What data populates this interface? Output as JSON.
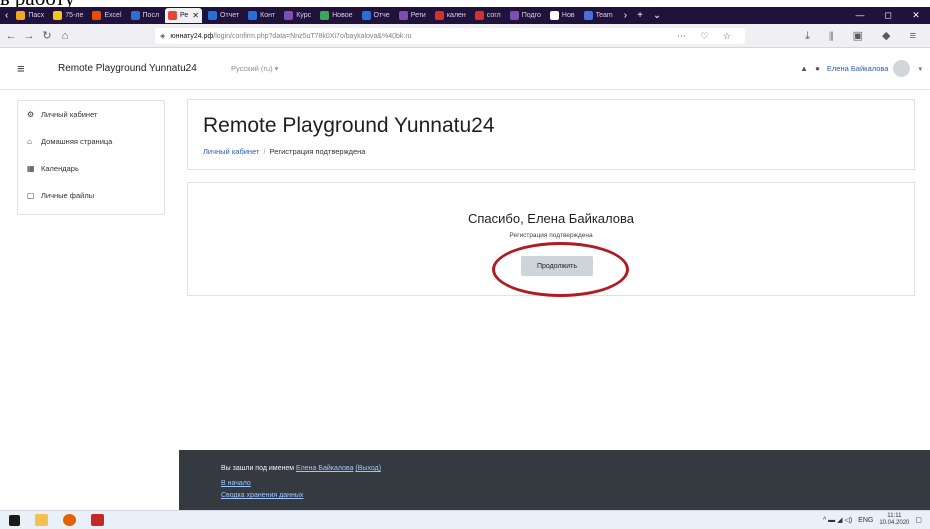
{
  "doc_fragment": "ь работу",
  "browser": {
    "tabs": [
      {
        "label": "Пасх",
        "color": "#f5a623"
      },
      {
        "label": "75-ле",
        "color": "#f5c518"
      },
      {
        "label": "Excel",
        "color": "#e65100"
      },
      {
        "label": "Посл",
        "color": "#2b6fd6"
      },
      {
        "label": "Ре",
        "color": "#e2483d",
        "active": true
      },
      {
        "label": "Отчет",
        "color": "#2b6fd6"
      },
      {
        "label": "Конт",
        "color": "#2b6fd6"
      },
      {
        "label": "Курс",
        "color": "#7b4fb0"
      },
      {
        "label": "Новое",
        "color": "#3aa857"
      },
      {
        "label": "Отче",
        "color": "#2b6fd6"
      },
      {
        "label": "Рети",
        "color": "#7b4fb0"
      },
      {
        "label": "кален",
        "color": "#d93025"
      },
      {
        "label": "согл",
        "color": "#d93025"
      },
      {
        "label": "Подго",
        "color": "#7b4fb0"
      },
      {
        "label": "Нов",
        "color": "#ffffff"
      },
      {
        "label": "Team",
        "color": "#4a6fd8"
      }
    ],
    "new_tab": "+",
    "url_host": "юннату24.рф",
    "url_path": "/login/confirm.php?data=Nnz5uT78k0Xi7o/baykalova&%40bk.ru",
    "url_actions": "⋯ ♡ ☆",
    "toolbar_right": "⤓ ⦀ ▣ ◆ ≡",
    "win_controls": [
      "—",
      "◻",
      "✕"
    ]
  },
  "header": {
    "site_name": "Remote Playground Yunnatu24",
    "language": "Русский (ru) ▾",
    "user_name": "Елена Байкалова",
    "icons": [
      "bell-icon",
      "chat-icon"
    ]
  },
  "sidebar": {
    "items": [
      {
        "label": "Личный кабинет",
        "icon": "⚙"
      },
      {
        "label": "Домашняя страница",
        "icon": "⌂"
      },
      {
        "label": "Календарь",
        "icon": "▦"
      },
      {
        "label": "Личные файлы",
        "icon": "▢"
      }
    ]
  },
  "page": {
    "title": "Remote Playground Yunnatu24",
    "breadcrumb": {
      "home": "Личный кабинет",
      "separator": "/",
      "current": "Регистрация подтверждена"
    }
  },
  "confirmation": {
    "thanks": "Спасибо, Елена Байкалова",
    "message": "Регистрация подтверждена",
    "button": "Продолжить"
  },
  "footer": {
    "logged_in_prefix": "Вы зашли под именем",
    "user_link": "Елена Байкалова",
    "logout_link": "(Выход)",
    "home_link": "В начало",
    "data_link": "Сводка хранения данных"
  },
  "taskbar": {
    "lang": "ENG",
    "time": "11:11",
    "date": "10.04.2020"
  },
  "colors": {
    "accent": "#2a5cb6",
    "highlight": "#b01c24",
    "footer_bg": "#343a40",
    "button_bg": "#ced4da"
  }
}
